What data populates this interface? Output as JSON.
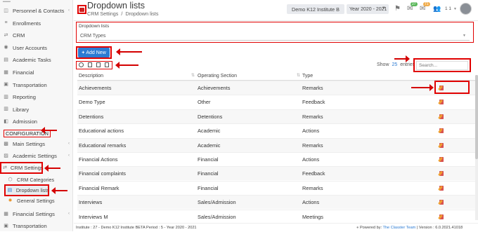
{
  "sidebar": {
    "items": [
      {
        "label": "Personnel & Contacts",
        "icon": "contacts-icon",
        "chev": true
      },
      {
        "label": "Enrollments",
        "icon": "enroll-icon"
      },
      {
        "label": "CRM",
        "icon": "crm-icon"
      },
      {
        "label": "User Accounts",
        "icon": "user-icon"
      },
      {
        "label": "Academic Tasks",
        "icon": "tasks-icon"
      },
      {
        "label": "Financial",
        "icon": "financial-icon"
      },
      {
        "label": "Transportation",
        "icon": "bus-icon"
      },
      {
        "label": "Reporting",
        "icon": "chart-icon"
      },
      {
        "label": "Library",
        "icon": "library-icon"
      },
      {
        "label": "Admission",
        "icon": "admission-icon"
      }
    ],
    "config_header": "CONFIGURATION",
    "config_items": [
      {
        "label": "Main Settings",
        "icon": "settings-icon",
        "chev": true
      },
      {
        "label": "Academic Settings",
        "icon": "academic-icon",
        "chev": true
      },
      {
        "label": "CRM Settings",
        "icon": "crm-icon",
        "chev": true,
        "active": true
      }
    ],
    "crm_sub": [
      {
        "label": "CRM Categories",
        "icon": "tag-icon"
      },
      {
        "label": "Dropdown lists",
        "icon": "list-icon",
        "selected": true
      },
      {
        "label": "General Settings",
        "icon": "gear-icon"
      }
    ],
    "bottom_items": [
      {
        "label": "Financial Settings",
        "icon": "financial-icon",
        "chev": true
      },
      {
        "label": "Transportation",
        "icon": "bus-icon"
      }
    ]
  },
  "header": {
    "title": "Dropdown lists",
    "breadcrumb_root": "CRM Settings",
    "breadcrumb_sep": "/",
    "breadcrumb_current": "Dropdown lists",
    "institute_button": "Demo K12 Institute B",
    "year_select": "Year 2020 - 2021",
    "notif_badges": [
      "27",
      "71"
    ],
    "user_menu": "1 1"
  },
  "panel": {
    "label": "Dropdown lists",
    "select_value": "CRM Types"
  },
  "toolbar": {
    "add_new": "Add New",
    "show_label": "Show",
    "show_count": "25",
    "entries_label": "entries",
    "search_placeholder": "Search..."
  },
  "table": {
    "headers": [
      "Description",
      "Operating Section",
      "Type"
    ],
    "rows": [
      [
        "Achievements",
        "Achievements",
        "Remarks"
      ],
      [
        "Demo Type",
        "Other",
        "Feedback"
      ],
      [
        "Detentions",
        "Detentions",
        "Remarks"
      ],
      [
        "Educational actions",
        "Academic",
        "Actions"
      ],
      [
        "Educational remarks",
        "Academic",
        "Remarks"
      ],
      [
        "Financial Actions",
        "Financial",
        "Actions"
      ],
      [
        "Financial complaints",
        "Financial",
        "Feedback"
      ],
      [
        "Financial Remark",
        "Financial",
        "Remarks"
      ],
      [
        "Interviews",
        "Sales/Admission",
        "Actions"
      ],
      [
        "Interviews M",
        "Sales/Admission",
        "Meetings"
      ]
    ]
  },
  "footer": {
    "left": "Institute : 27 - Demo K12 Institute BETA Period : 5 - Year 2020 - 2021",
    "powered_prefix": "Powered by:",
    "powered_by": "The Classter Team",
    "version": "| Version : 6.0.2021.41018"
  },
  "colors": {
    "accent": "#2c7bd3",
    "annotation": "#e00000",
    "primary_button": "#2c7bd3",
    "delete": "#d9534f",
    "edit": "#f0a030"
  }
}
